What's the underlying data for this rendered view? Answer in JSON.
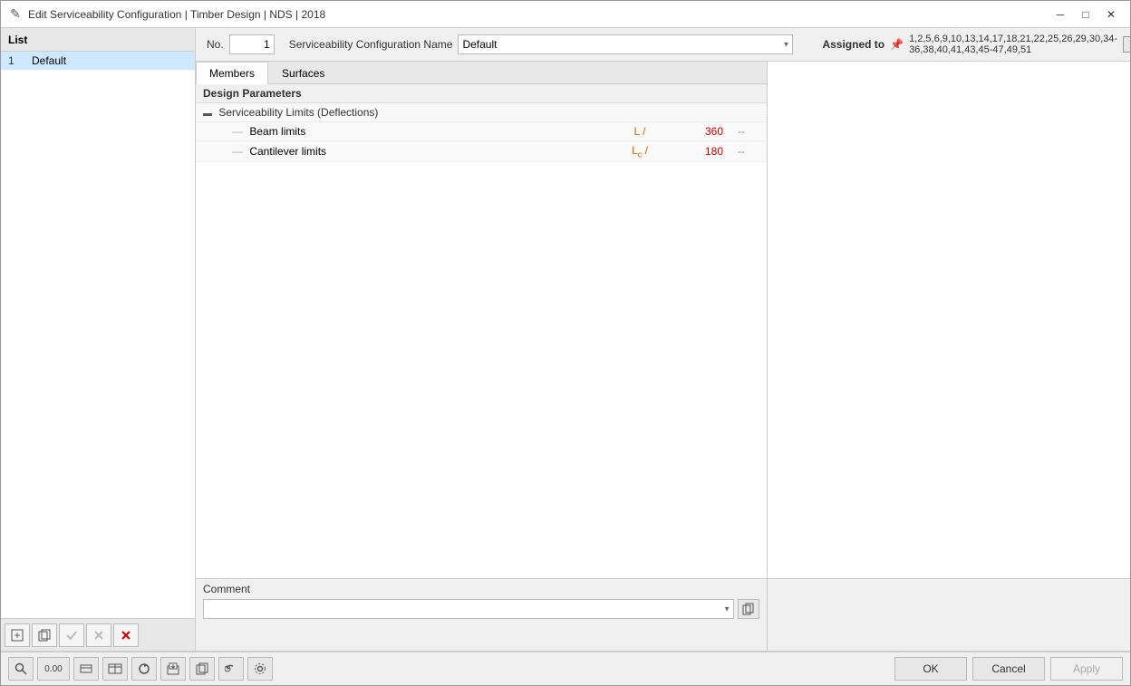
{
  "window": {
    "title": "Edit Serviceability Configuration | Timber Design | NDS | 2018",
    "icon": "✎"
  },
  "titlebar": {
    "minimize_label": "─",
    "maximize_label": "□",
    "close_label": "✕"
  },
  "left_panel": {
    "header": "List",
    "items": [
      {
        "num": "1",
        "name": "Default"
      }
    ]
  },
  "left_toolbar": {
    "add_btn": "📄",
    "copy_btn": "📋",
    "check_btn": "✓",
    "uncheck_btn": "✗",
    "delete_btn": "✕"
  },
  "config_header": {
    "no_label": "No.",
    "no_value": "1",
    "name_label": "Serviceability Configuration Name",
    "name_value": "Default"
  },
  "assigned": {
    "label": "Assigned to",
    "icon": "📌",
    "values": "1,2,5,6,9,10,13,14,17,18,21,22,25,26,29,30,34-36,38,40,41,43,45-47,49,51"
  },
  "tabs": {
    "members_label": "Members",
    "surfaces_label": "Surfaces",
    "active": "members"
  },
  "design_params": {
    "section_header": "Design Parameters",
    "serviceability_limits": {
      "label": "Serviceability Limits (Deflections)",
      "beam_limits": {
        "label": "Beam limits",
        "formula": "L /",
        "value": "360",
        "suffix": "--"
      },
      "cantilever_limits": {
        "label": "Cantilever limits",
        "formula_pre": "L",
        "formula_sub": "c",
        "formula_post": " /",
        "value": "180",
        "suffix": "--"
      }
    }
  },
  "comment": {
    "label": "Comment",
    "placeholder": "",
    "copy_btn": "⧉"
  },
  "bottom_toolbar": {
    "tools": [
      {
        "icon": "🔍",
        "name": "search"
      },
      {
        "icon": "0.00",
        "name": "decimal"
      },
      {
        "icon": "▭",
        "name": "view1"
      },
      {
        "icon": "↔",
        "name": "view2"
      },
      {
        "icon": "🔄",
        "name": "refresh1"
      },
      {
        "icon": "📤",
        "name": "export"
      },
      {
        "icon": "📋",
        "name": "copy"
      },
      {
        "icon": "↺",
        "name": "undo"
      },
      {
        "icon": "⚙",
        "name": "settings"
      }
    ]
  },
  "dialog_buttons": {
    "ok_label": "OK",
    "cancel_label": "Cancel",
    "apply_label": "Apply"
  }
}
